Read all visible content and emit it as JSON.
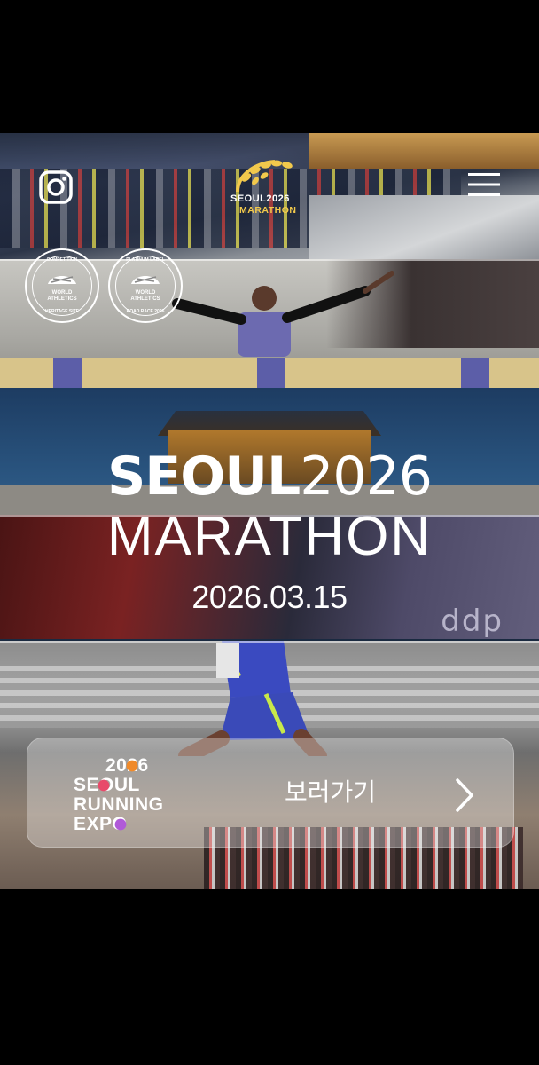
{
  "header": {
    "logo_line1": "SEOUL2026",
    "logo_line2": "MARATHON",
    "instagram_icon": "instagram-icon",
    "menu_icon": "hamburger-menu-icon"
  },
  "badges": [
    {
      "top": "COMPETITION",
      "mid1": "WORLD",
      "mid2": "ATHLETICS",
      "bottom": "HERITAGE SITE"
    },
    {
      "top": "PLATINUM LABEL",
      "mid1": "WORLD",
      "mid2": "ATHLETICS",
      "bottom": "ROAD RACE 2026"
    }
  ],
  "hero": {
    "title_bold": "SEOUL",
    "title_year": "2026",
    "subtitle": "MARATHON",
    "date": "2026.03.15",
    "banner_text": "SEOUL 2026",
    "banner_text2": "MARATHON",
    "ddp_text": "ddp"
  },
  "expo": {
    "logo_year": "2026",
    "logo_line1": "SEOUL",
    "logo_line2": "RUNNING",
    "logo_line3": "EXPO",
    "cta_label": "보러가기",
    "cta_icon": "chevron-right-icon"
  },
  "colors": {
    "background": "#000000",
    "logo_gold": "#f2c94c",
    "card_overlay": "rgba(255,255,255,0.33)"
  }
}
